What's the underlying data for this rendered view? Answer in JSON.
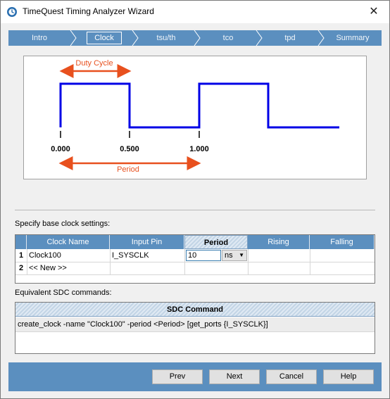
{
  "window": {
    "title": "TimeQuest Timing Analyzer Wizard",
    "close_glyph": "✕"
  },
  "steps": [
    "Intro",
    "Clock",
    "tsu/th",
    "tco",
    "tpd",
    "Summary"
  ],
  "active_step": "Clock",
  "diagram": {
    "duty_cycle_label": "Duty Cycle",
    "period_label": "Period",
    "ticks": [
      "0.000",
      "0.500",
      "1.000"
    ],
    "colors": {
      "waveform": "#0000e6",
      "annotation": "#e8501e"
    }
  },
  "clock_settings": {
    "label": "Specify base clock settings:",
    "columns": [
      "Clock Name",
      "Input Pin",
      "Period",
      "Rising",
      "Falling"
    ],
    "rows": [
      {
        "num": "1",
        "clock_name": "Clock100",
        "input_pin": "I_SYSCLK",
        "period": "10",
        "unit": "ns",
        "rising": "",
        "falling": ""
      },
      {
        "num": "2",
        "clock_name": "<< New >>",
        "input_pin": "",
        "period": "",
        "unit": "",
        "rising": "",
        "falling": ""
      }
    ]
  },
  "sdc": {
    "label": "Equivalent SDC commands:",
    "header": "SDC Command",
    "command": "create_clock -name \"Clock100\" -period <Period> [get_ports {I_SYSCLK}]"
  },
  "buttons": {
    "prev": "Prev",
    "next": "Next",
    "cancel": "Cancel",
    "help": "Help"
  }
}
